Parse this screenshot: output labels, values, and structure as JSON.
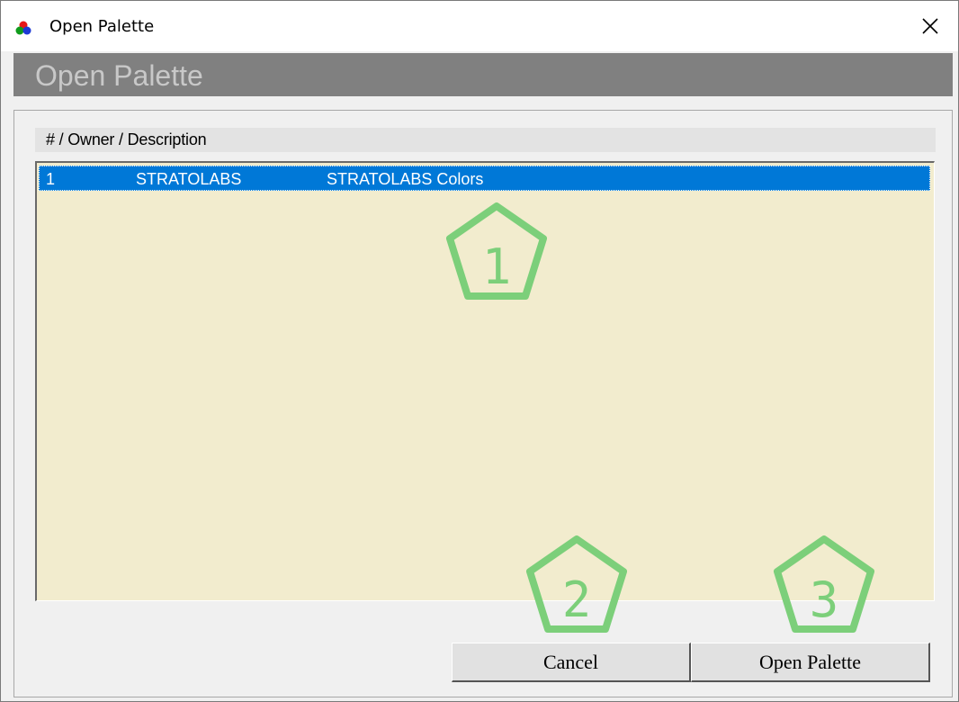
{
  "window": {
    "title": "Open Palette",
    "icon": "rgb-dots-icon",
    "close_icon": "close-icon"
  },
  "header": {
    "heading": "Open Palette"
  },
  "list": {
    "column_header": "# / Owner / Description",
    "rows": [
      {
        "number": "1",
        "owner": "STRATOLABS",
        "description": "STRATOLABS Colors",
        "selected": true
      }
    ]
  },
  "annotations": {
    "markers": [
      "1",
      "2",
      "3"
    ],
    "color": "#7ccf7a"
  },
  "buttons": {
    "cancel_label": "Cancel",
    "open_label": "Open Palette"
  },
  "colors": {
    "selection": "#0078d7",
    "list_background": "#f2ecce",
    "header_band": "#808080"
  }
}
